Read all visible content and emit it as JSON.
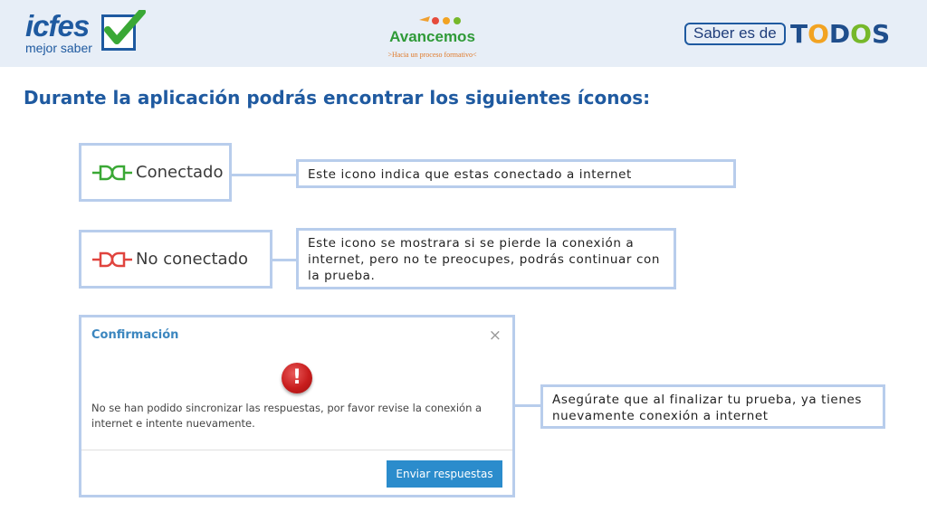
{
  "header": {
    "icfes_logo": {
      "word": "icfes",
      "tagline": "mejor saber"
    },
    "avancemos_logo": {
      "word": "Avancemos",
      "tagline": ">Hacia un proceso formativo<"
    },
    "saber_logo": {
      "prefix": "Saber es de",
      "word": [
        "T",
        "O",
        "D",
        "O",
        "S"
      ],
      "letter_colors": [
        "#1f4e8c",
        "#f2a322",
        "#1f4e8c",
        "#76b82a",
        "#1f4e8c"
      ]
    }
  },
  "title": "Durante la aplicación podrás encontrar los siguientes íconos:",
  "connected": {
    "label": "Conectado",
    "icon": "plug-connected-icon",
    "color": "#3aa835",
    "description": "Este icono indica que estas conectado a internet"
  },
  "disconnected": {
    "label": "No conectado",
    "icon": "plug-disconnected-icon",
    "color": "#e0443e",
    "description": "Este icono se mostrara si se pierde la conexión a internet, pero no te preocupes, podrás continuar con la prueba."
  },
  "dialog": {
    "title": "Confirmación",
    "close": "×",
    "alert_glyph": "!",
    "message": "No se han podido sincronizar las respuestas, por favor revise la conexión a internet e intente nuevamente.",
    "button": "Enviar respuestas"
  },
  "dialog_note": "Asegúrate que al finalizar tu prueba, ya tienes nuevamente conexión a internet",
  "colors": {
    "accent": "#1f5aa0",
    "box_border": "#b8cdec",
    "button": "#2b8ccc"
  }
}
